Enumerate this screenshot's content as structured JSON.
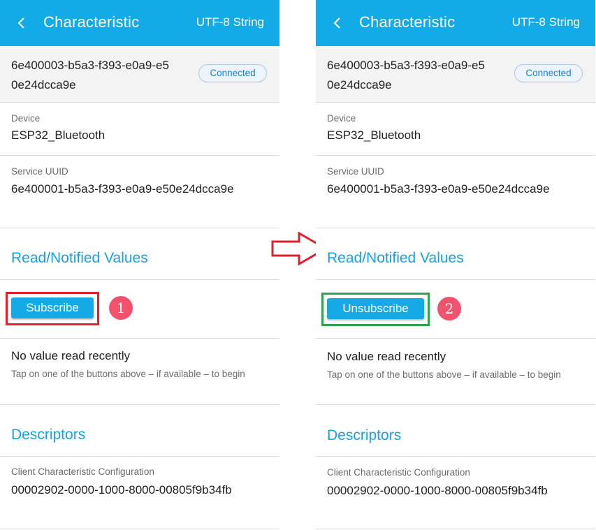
{
  "colors": {
    "app_bar": "#12abe8",
    "section_title": "#15a2dd",
    "button": "#15a9e6",
    "badge_text": "#1a7fc4",
    "highlight_subscribe": "#e0202a",
    "highlight_unsubscribe": "#2ea44f",
    "step_badge": "#f4516c",
    "flow_arrow": "#e0202a"
  },
  "icons": {
    "back": "chevron-left-icon",
    "flow": "right-arrow-icon"
  },
  "panels": [
    {
      "app_bar": {
        "title": "Characteristic",
        "format": "UTF-8 String"
      },
      "characteristic_uuid": "6e400003-b5a3-f393-e0a9-e50e24dcca9e",
      "status": "Connected",
      "device": {
        "label": "Device",
        "value": "ESP32_Bluetooth"
      },
      "service": {
        "label": "Service UUID",
        "value": "6e400001-b5a3-f393-e0a9-e50e24dcca9e"
      },
      "values_section": {
        "title": "Read/Notified Values"
      },
      "action_button": "Subscribe",
      "step": "1",
      "no_value": {
        "title": "No value read recently",
        "hint": "Tap on one of the buttons above – if available – to begin"
      },
      "descriptors": {
        "title": "Descriptors",
        "label": "Client Characteristic Configuration",
        "value": "00002902-0000-1000-8000-00805f9b34fb"
      }
    },
    {
      "app_bar": {
        "title": "Characteristic",
        "format": "UTF-8 String"
      },
      "characteristic_uuid": "6e400003-b5a3-f393-e0a9-e50e24dcca9e",
      "status": "Connected",
      "device": {
        "label": "Device",
        "value": "ESP32_Bluetooth"
      },
      "service": {
        "label": "Service UUID",
        "value": "6e400001-b5a3-f393-e0a9-e50e24dcca9e"
      },
      "values_section": {
        "title": "Read/Notified Values"
      },
      "action_button": "Unsubscribe",
      "step": "2",
      "no_value": {
        "title": "No value read recently",
        "hint": "Tap on one of the buttons above – if available – to begin"
      },
      "descriptors": {
        "title": "Descriptors",
        "label": "Client Characteristic Configuration",
        "value": "00002902-0000-1000-8000-00805f9b34fb"
      }
    }
  ]
}
